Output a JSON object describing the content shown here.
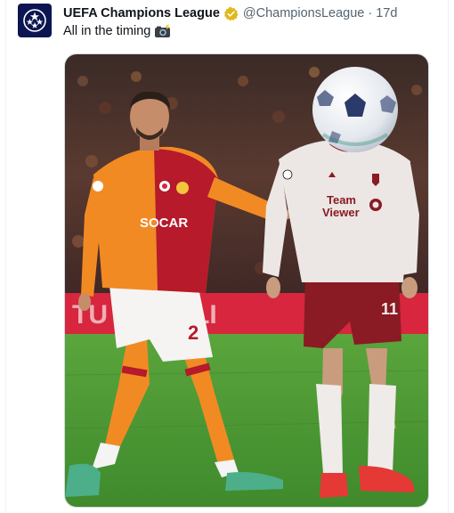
{
  "tweet": {
    "author_name": "UEFA Champions League",
    "handle": "@ChampionsLeague",
    "separator": "·",
    "timestamp": "17d",
    "text": "All in the timing",
    "text_emoji": "camera-flash"
  },
  "media": {
    "billboard_text": "TU  AI AIRLI",
    "left_player": {
      "shirt_sponsor": "SOCAR",
      "shorts_number": "2"
    },
    "right_player": {
      "shirt_sponsor_line1": "Team",
      "shirt_sponsor_line2": "Viewer",
      "shorts_number": "11"
    }
  },
  "colors": {
    "verified_gold": "#e2b719",
    "handle_gray": "#536471",
    "galatasaray_orange": "#f28a24",
    "galatasaray_red": "#b61a2b",
    "united_white": "#ece7e4",
    "united_maroon": "#8a1a24",
    "pitch_green": "#4f9a34"
  }
}
